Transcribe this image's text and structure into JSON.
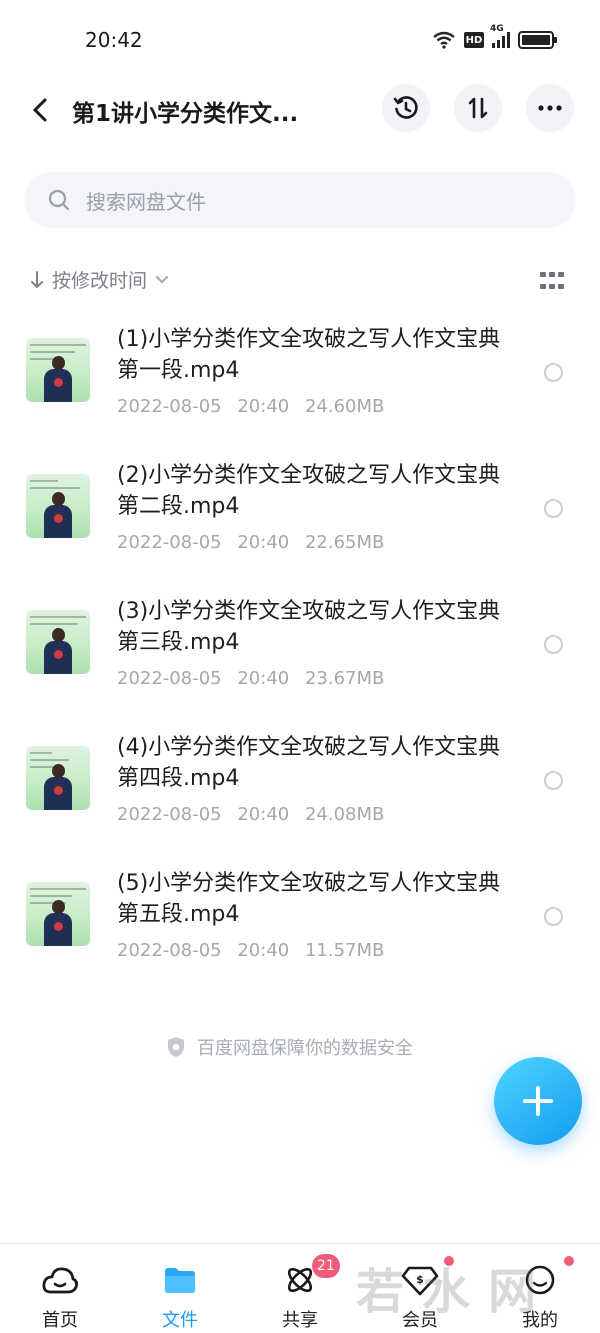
{
  "status": {
    "time": "20:42",
    "hd": "HD",
    "network": "4G"
  },
  "header": {
    "title": "第1讲小学分类作文...",
    "icons": [
      "history-icon",
      "sort-toggle-icon",
      "more-icon"
    ]
  },
  "search": {
    "placeholder": "搜索网盘文件"
  },
  "sort": {
    "label": "按修改时间"
  },
  "files": [
    {
      "name": "(1)小学分类作文全攻破之写人作文宝典第一段.mp4",
      "date": "2022-08-05",
      "time": "20:40",
      "size": "24.60MB"
    },
    {
      "name": "(2)小学分类作文全攻破之写人作文宝典第二段.mp4",
      "date": "2022-08-05",
      "time": "20:40",
      "size": "22.65MB"
    },
    {
      "name": "(3)小学分类作文全攻破之写人作文宝典第三段.mp4",
      "date": "2022-08-05",
      "time": "20:40",
      "size": "23.67MB"
    },
    {
      "name": "(4)小学分类作文全攻破之写人作文宝典第四段.mp4",
      "date": "2022-08-05",
      "time": "20:40",
      "size": "24.08MB"
    },
    {
      "name": "(5)小学分类作文全攻破之写人作文宝典第五段.mp4",
      "date": "2022-08-05",
      "time": "20:40",
      "size": "11.57MB"
    }
  ],
  "footer_note": "百度网盘保障你的数据安全",
  "nav": {
    "items": [
      {
        "label": "首页",
        "icon": "cloud-home-icon"
      },
      {
        "label": "文件",
        "icon": "folder-icon",
        "active": true
      },
      {
        "label": "共享",
        "icon": "share-icon",
        "badge": "21"
      },
      {
        "label": "会员",
        "icon": "vip-icon"
      },
      {
        "label": "我的",
        "icon": "profile-icon"
      }
    ]
  },
  "watermark": "若水网",
  "colors": {
    "accent": "#1c9cf0",
    "badge": "#f25a7a",
    "muted_text": "#a3a8ae"
  }
}
